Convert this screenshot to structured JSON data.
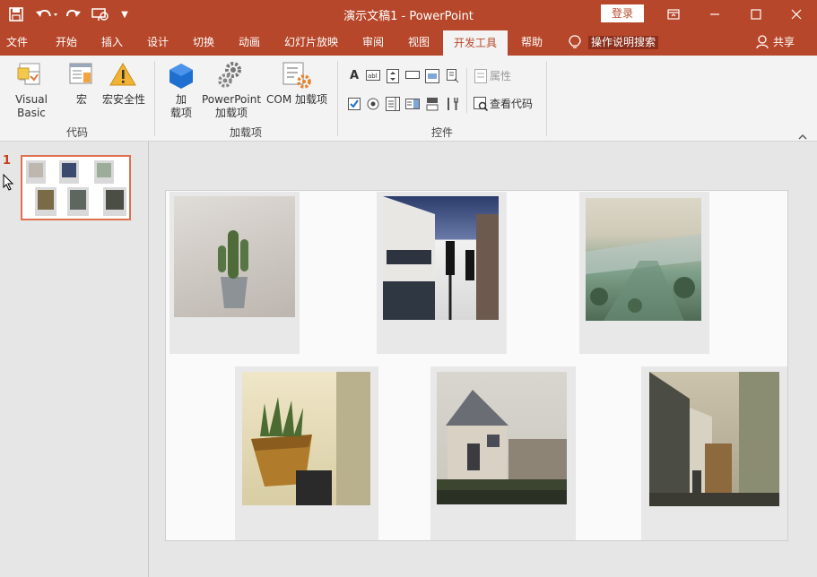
{
  "app": {
    "window_title": "演示文稿1  -  PowerPoint",
    "login_label": "登录"
  },
  "tabs": [
    "文件",
    "开始",
    "插入",
    "设计",
    "切换",
    "动画",
    "幻灯片放映",
    "审阅",
    "视图",
    "开发工具",
    "帮助"
  ],
  "tell_me": "操作说明搜索",
  "share": "共享",
  "ribbon": {
    "code_group": {
      "visual_basic": "Visual Basic",
      "macros": "宏",
      "macro_security": "宏安全性",
      "label": "代码"
    },
    "addins_group": {
      "addins_line1": "加",
      "addins_line2": "载项",
      "ppt_addins_line1": "PowerPoint",
      "ppt_addins_line2": "加载项",
      "com_addins": "COM 加载项",
      "label": "加载项"
    },
    "controls_group": {
      "properties": "属性",
      "view_code": "查看代码",
      "label": "控件"
    }
  },
  "slides_pane": {
    "slide_number": "1"
  },
  "colors": {
    "accent": "#b7472a",
    "ribbon_bg": "#f3f3f3",
    "thumb_border": "#e07050"
  },
  "icons": [
    "save-icon",
    "undo-icon",
    "redo-icon",
    "present-icon",
    "customize-icon",
    "lightbulb-icon",
    "person-icon",
    "minimize-icon",
    "maximize-icon",
    "close-icon",
    "restore-ribbon-icon"
  ]
}
